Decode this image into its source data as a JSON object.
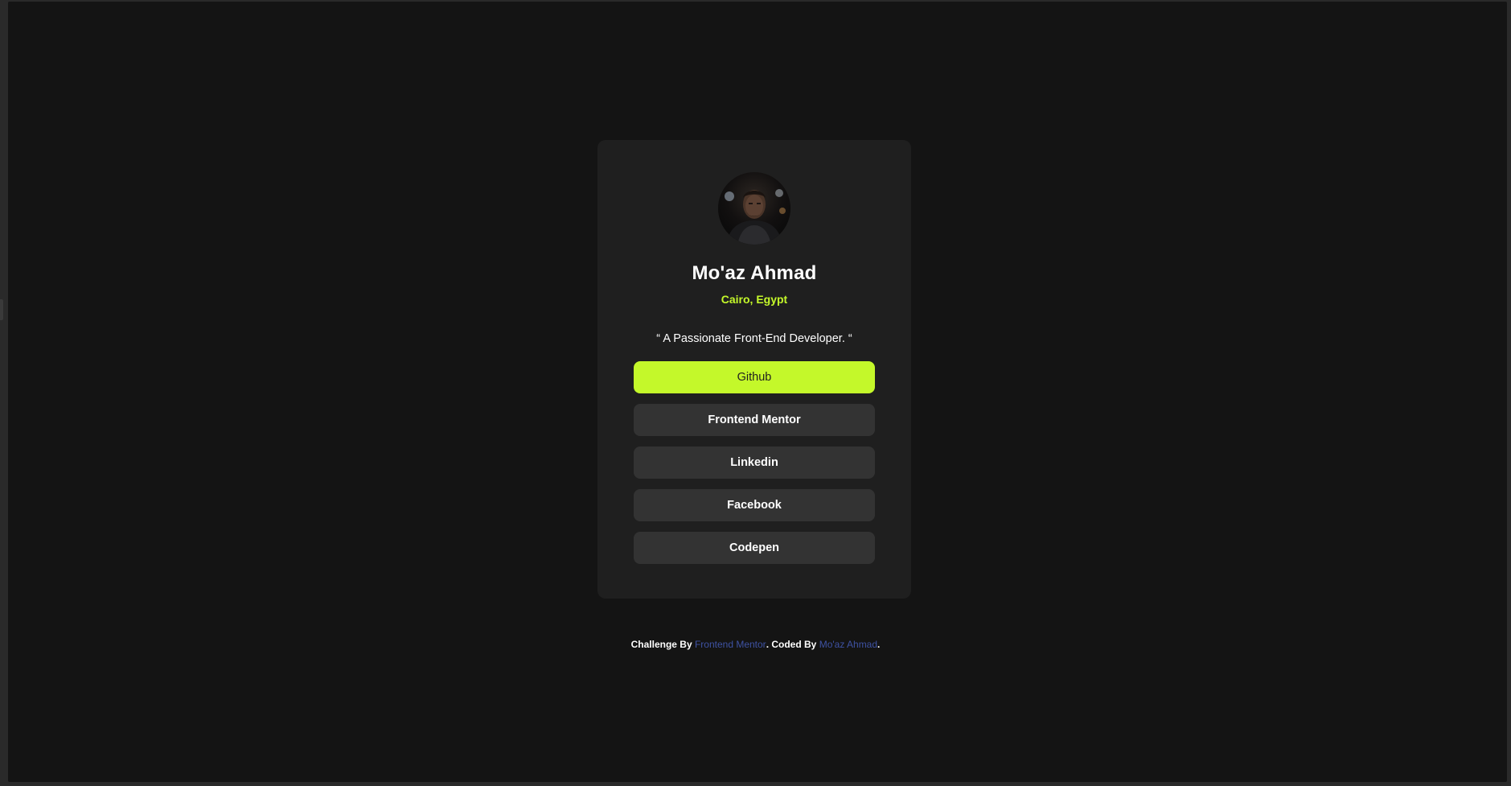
{
  "profile": {
    "avatar_alt": "Mo'az Ahmad avatar",
    "name": "Mo'az Ahmad",
    "location": "Cairo, Egypt",
    "bio": "“ A Passionate Front-End Developer. “"
  },
  "links": [
    {
      "label": "Github",
      "active": true
    },
    {
      "label": "Frontend Mentor",
      "active": false
    },
    {
      "label": "Linkedin",
      "active": false
    },
    {
      "label": "Facebook",
      "active": false
    },
    {
      "label": "Codepen",
      "active": false
    }
  ],
  "attribution": {
    "prefix": "Challenge By ",
    "challenge_link": "Frontend Mentor",
    "middle": ". Coded By ",
    "author_link": "Mo'az Ahmad",
    "suffix": "."
  },
  "colors": {
    "accent": "#c4f82a",
    "card": "#1f1f1f",
    "background": "#141414",
    "button": "#333333",
    "link": "#3e52a3"
  }
}
